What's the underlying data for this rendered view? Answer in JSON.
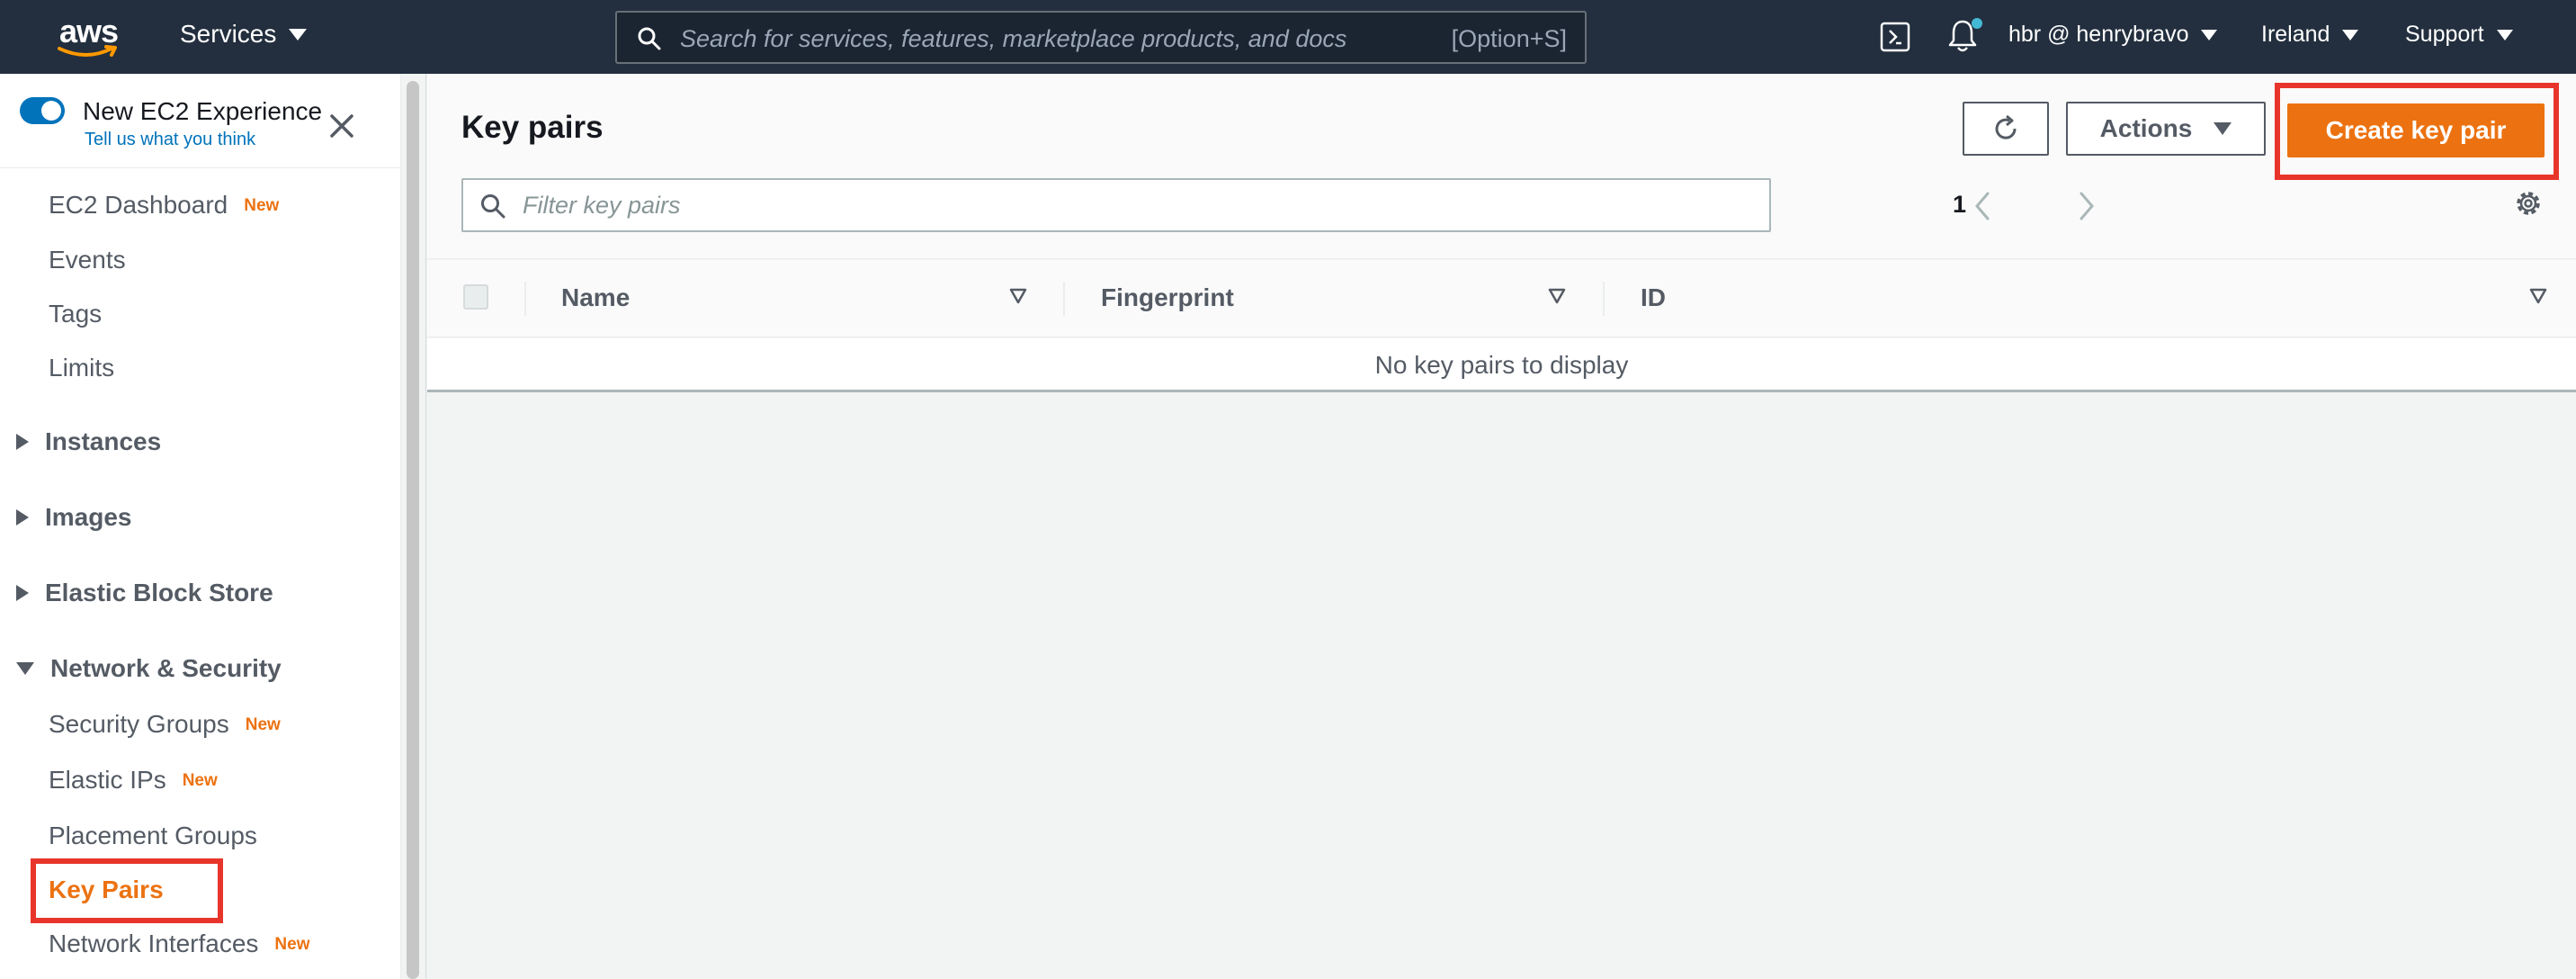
{
  "topnav": {
    "logo_text": "aws",
    "services_label": "Services",
    "search_placeholder": "Search for services, features, marketplace products, and docs",
    "search_shortcut": "[Option+S]",
    "account_label": "hbr @ henrybravo",
    "region_label": "Ireland",
    "support_label": "Support",
    "bg_color": "#232f3e"
  },
  "sidebar": {
    "experience_title": "New EC2 Experience",
    "experience_link": "Tell us what you think",
    "new_badge": "New",
    "items": {
      "ec2_dashboard": "EC2 Dashboard",
      "events": "Events",
      "tags": "Tags",
      "limits": "Limits",
      "security_groups": "Security Groups",
      "elastic_ips": "Elastic IPs",
      "placement_groups": "Placement Groups",
      "key_pairs": "Key Pairs",
      "network_interfaces": "Network Interfaces"
    },
    "sections": {
      "instances": "Instances",
      "images": "Images",
      "elastic_block_store": "Elastic Block Store",
      "network_security": "Network & Security"
    },
    "active_item": "Key Pairs",
    "accent_color": "#ec7211"
  },
  "main": {
    "title": "Key pairs",
    "actions_label": "Actions",
    "create_label": "Create key pair",
    "filter_placeholder": "Filter key pairs",
    "page_number": "1",
    "columns": [
      "Name",
      "Fingerprint",
      "ID"
    ],
    "empty_message": "No key pairs to display",
    "primary_color": "#ec7211",
    "highlight_color": "#e8352b"
  }
}
